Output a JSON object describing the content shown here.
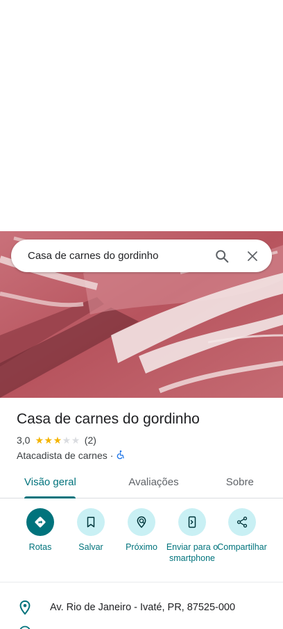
{
  "search": {
    "query": "Casa de carnes do gordinho"
  },
  "place": {
    "name": "Casa de carnes do gordinho",
    "rating_text": "3,0",
    "rating_value": 3,
    "rating_max": 5,
    "review_count": "(2)",
    "category": "Atacadista de carnes",
    "separator": "·"
  },
  "tabs": [
    {
      "label": "Visão geral",
      "active": true
    },
    {
      "label": "Avaliações",
      "active": false
    },
    {
      "label": "Sobre",
      "active": false
    }
  ],
  "actions": [
    {
      "label": "Rotas",
      "icon": "directions-icon"
    },
    {
      "label": "Salvar",
      "icon": "bookmark-icon"
    },
    {
      "label": "Próximo",
      "icon": "nearby-icon"
    },
    {
      "label": "Enviar para o smartphone",
      "icon": "send-to-phone-icon"
    },
    {
      "label": "Compartilhar",
      "icon": "share-icon"
    }
  ],
  "address": "Av. Rio de Janeiro - Ivaté, PR, 87525-000",
  "colors": {
    "accent": "#00737c",
    "accent_light": "#c9f0f4",
    "star": "#f4b400"
  }
}
